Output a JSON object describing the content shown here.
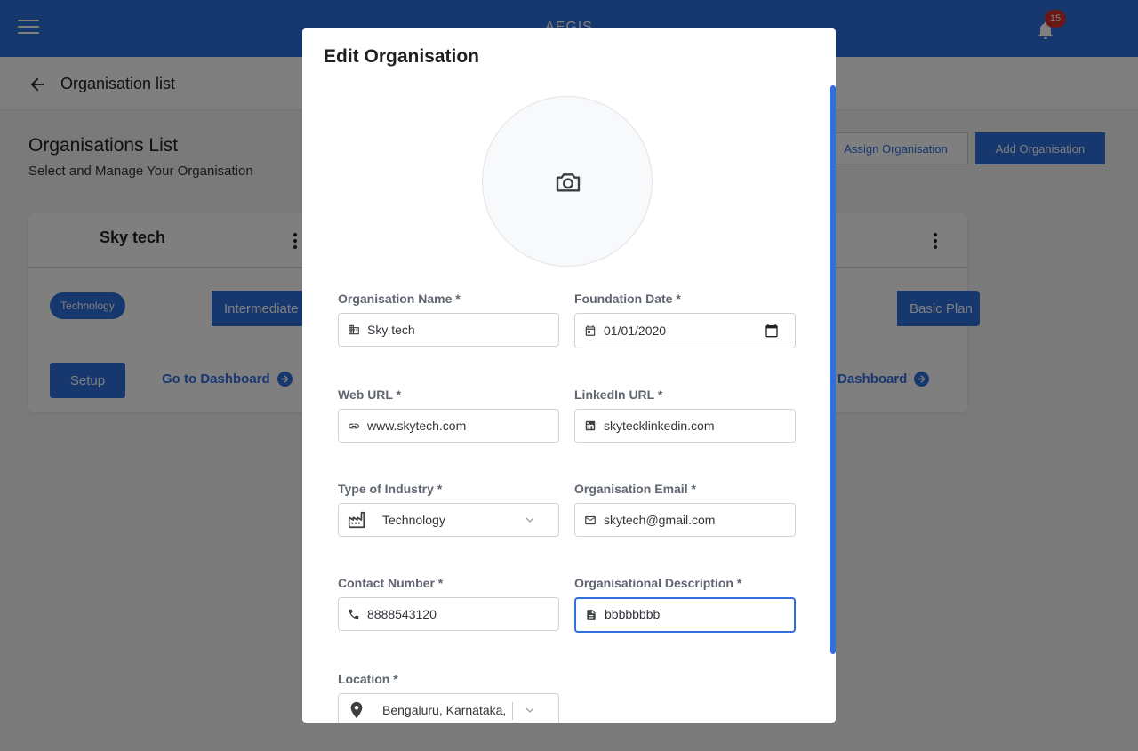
{
  "app": {
    "title": "AEGIS",
    "notification_count": "15"
  },
  "subheader": {
    "title": "Organisation list"
  },
  "page": {
    "title": "Organisations List",
    "subtitle": "Select and Manage Your Organisation",
    "assign_button": "Assign Organisation",
    "add_button": "Add Organisation"
  },
  "cards": [
    {
      "name": "Sky tech",
      "industry_chip": "Technology",
      "plan": "Intermediate",
      "setup_label": "Setup",
      "dashboard_link": "Go to Dashboard"
    },
    {
      "name": "",
      "plan": "Basic Plan",
      "dashboard_link": "Dashboard"
    }
  ],
  "modal": {
    "title": "Edit Organisation",
    "fields": {
      "org_name": {
        "label": "Organisation Name *",
        "value": "Sky tech",
        "icon": "building-icon"
      },
      "foundation_date": {
        "label": "Foundation Date *",
        "value": "01/01/2020",
        "icon": "calendar-icon"
      },
      "web_url": {
        "label": "Web URL *",
        "value": "www.skytech.com",
        "icon": "link-icon"
      },
      "linkedin_url": {
        "label": "LinkedIn URL *",
        "value": "skytecklinkedin.com",
        "icon": "linkedin-icon"
      },
      "industry": {
        "label": "Type of Industry *",
        "value": "Technology",
        "icon": "factory-icon"
      },
      "org_email": {
        "label": "Organisation Email *",
        "value": "skytech@gmail.com",
        "icon": "mail-icon"
      },
      "contact": {
        "label": "Contact Number *",
        "value": "8888543120",
        "icon": "phone-icon"
      },
      "description": {
        "label": "Organisational Description *",
        "value": "bbbbbbbb",
        "icon": "document-icon"
      },
      "location": {
        "label": "Location *",
        "value": "Bengaluru, Karnataka,",
        "icon": "location-pin-icon"
      }
    }
  },
  "colors": {
    "primary": "#2f6fde",
    "badge": "#d32f2f",
    "overlay": "rgba(0,0,0,0.5)"
  }
}
